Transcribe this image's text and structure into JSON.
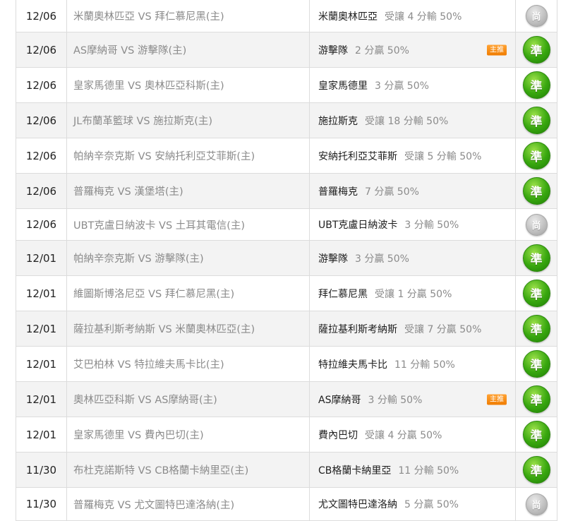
{
  "rows": [
    {
      "date": "12/06",
      "match": "米蘭奧林匹亞 VS 拜仁慕尼黑(主)",
      "pick_team": "米蘭奧林匹亞",
      "pick_line": "受讓 4 分輸 50%",
      "badge": "",
      "result": "尚"
    },
    {
      "date": "12/06",
      "match": "AS摩納哥 VS 游擊隊(主)",
      "pick_team": "游擊隊",
      "pick_line": "2 分贏 50%",
      "badge": "主推",
      "result": "準"
    },
    {
      "date": "12/06",
      "match": "皇家馬德里 VS 奧林匹亞科斯(主)",
      "pick_team": "皇家馬德里",
      "pick_line": "3 分贏 50%",
      "badge": "",
      "result": "準"
    },
    {
      "date": "12/06",
      "match": "JL布蘭革籃球 VS 施拉斯克(主)",
      "pick_team": "施拉斯克",
      "pick_line": "受讓 18 分輸 50%",
      "badge": "",
      "result": "準"
    },
    {
      "date": "12/06",
      "match": "帕納辛奈克斯 VS 安納托利亞艾菲斯(主)",
      "pick_team": "安納托利亞艾菲斯",
      "pick_line": "受讓 5 分輸 50%",
      "badge": "",
      "result": "準"
    },
    {
      "date": "12/06",
      "match": "普羅梅克 VS 漢堡塔(主)",
      "pick_team": "普羅梅克",
      "pick_line": "7 分贏 50%",
      "badge": "",
      "result": "準"
    },
    {
      "date": "12/06",
      "match": "UBT克盧日納波卡 VS 土耳其電信(主)",
      "pick_team": "UBT克盧日納波卡",
      "pick_line": "3 分輸 50%",
      "badge": "",
      "result": "尚"
    },
    {
      "date": "12/01",
      "match": "帕納辛奈克斯 VS 游擊隊(主)",
      "pick_team": "游擊隊",
      "pick_line": "3 分贏 50%",
      "badge": "",
      "result": "準"
    },
    {
      "date": "12/01",
      "match": "維圖斯博洛尼亞 VS 拜仁慕尼黑(主)",
      "pick_team": "拜仁慕尼黑",
      "pick_line": "受讓 1 分贏 50%",
      "badge": "",
      "result": "準"
    },
    {
      "date": "12/01",
      "match": "薩拉基利斯考納斯 VS 米蘭奧林匹亞(主)",
      "pick_team": "薩拉基利斯考納斯",
      "pick_line": "受讓 7 分贏 50%",
      "badge": "",
      "result": "準"
    },
    {
      "date": "12/01",
      "match": "艾巴柏林 VS 特拉維夫馬卡比(主)",
      "pick_team": "特拉維夫馬卡比",
      "pick_line": "11 分輸 50%",
      "badge": "",
      "result": "準"
    },
    {
      "date": "12/01",
      "match": "奧林匹亞科斯 VS AS摩納哥(主)",
      "pick_team": "AS摩納哥",
      "pick_line": "3 分輸 50%",
      "badge": "主推",
      "result": "準"
    },
    {
      "date": "12/01",
      "match": "皇家馬德里 VS 費內巴切(主)",
      "pick_team": "費內巴切",
      "pick_line": "受讓 4 分贏 50%",
      "badge": "",
      "result": "準"
    },
    {
      "date": "11/30",
      "match": "布杜克諾斯特 VS CB格蘭卡納里亞(主)",
      "pick_team": "CB格蘭卡納里亞",
      "pick_line": "11 分輸 50%",
      "badge": "",
      "result": "準"
    },
    {
      "date": "11/30",
      "match": "普羅梅克 VS 尤文圖特巴達洛納(主)",
      "pick_team": "尤文圖特巴達洛納",
      "pick_line": "5 分贏 50%",
      "badge": "",
      "result": "尚"
    }
  ]
}
